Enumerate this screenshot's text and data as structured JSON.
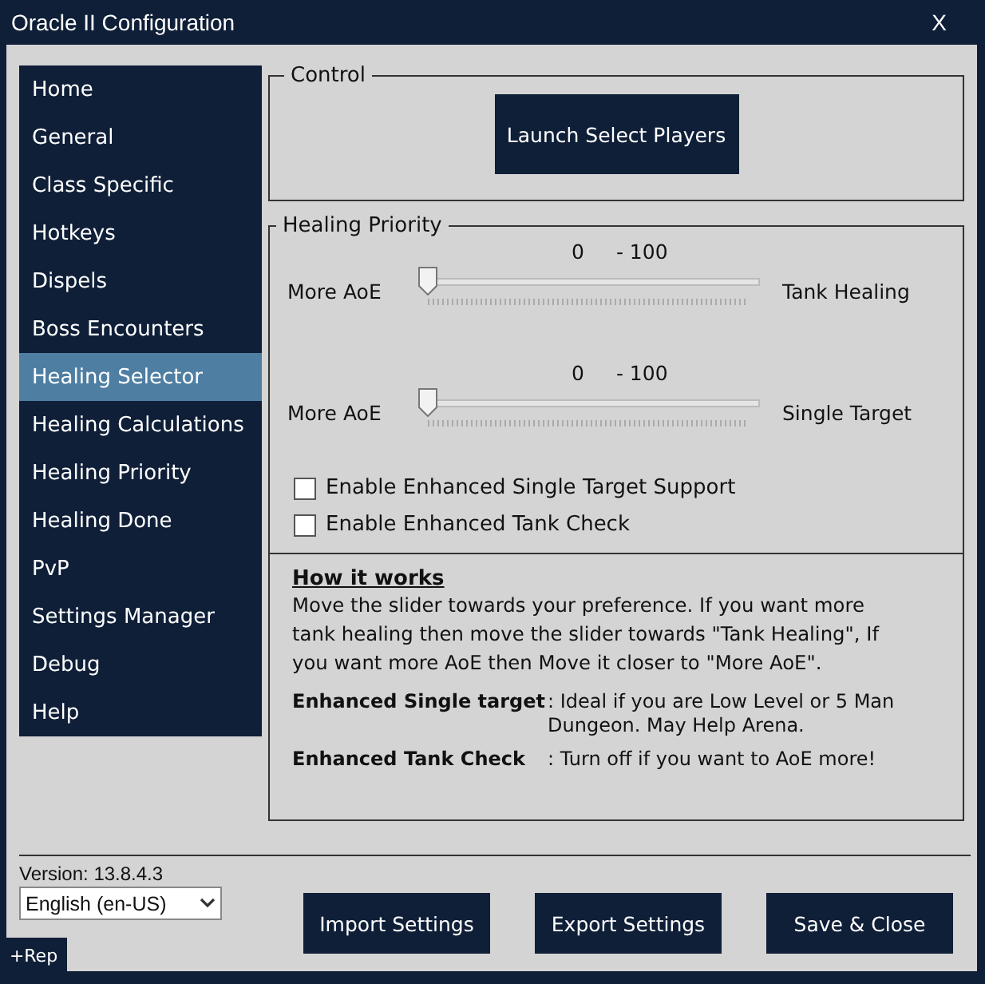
{
  "window": {
    "title": "Oracle II Configuration",
    "close": "X"
  },
  "sidebar": {
    "items": [
      {
        "label": "Home",
        "selected": false
      },
      {
        "label": "General",
        "selected": false
      },
      {
        "label": "Class Specific",
        "selected": false
      },
      {
        "label": "Hotkeys",
        "selected": false
      },
      {
        "label": "Dispels",
        "selected": false
      },
      {
        "label": "Boss Encounters",
        "selected": false
      },
      {
        "label": "Healing Selector",
        "selected": true
      },
      {
        "label": "Healing Calculations",
        "selected": false
      },
      {
        "label": "Healing Priority",
        "selected": false
      },
      {
        "label": "Healing Done",
        "selected": false
      },
      {
        "label": "PvP",
        "selected": false
      },
      {
        "label": "Settings Manager",
        "selected": false
      },
      {
        "label": "Debug",
        "selected": false
      },
      {
        "label": "Help",
        "selected": false
      }
    ]
  },
  "control": {
    "title": "Control",
    "button": "Launch Select Players"
  },
  "healing_priority": {
    "title": "Healing Priority",
    "sliders": [
      {
        "value": "0",
        "range": "- 100",
        "left_label": "More AoE",
        "right_label": "Tank Healing",
        "level": 0
      },
      {
        "value": "0",
        "range": "- 100",
        "left_label": "More AoE",
        "right_label": "Single Target",
        "level": 0
      }
    ],
    "checkboxes": [
      {
        "label": "Enable Enhanced Single Target Support",
        "checked": false
      },
      {
        "label": "Enable Enhanced Tank Check",
        "checked": false
      }
    ],
    "help": {
      "heading": "How it works",
      "text": "Move the slider towards your preference. If you want more tank healing then move the slider towards  \"Tank Healing\", If you want more AoE then Move it closer to \"More AoE\".",
      "definitions": [
        {
          "term": "Enhanced Single target",
          "description": ": Ideal if you are Low Level or 5 Man Dungeon. May Help Arena."
        },
        {
          "term": "Enhanced Tank Check",
          "description": ": Turn off if you want to AoE more!"
        }
      ]
    }
  },
  "footer": {
    "version": "Version: 13.8.4.3",
    "language": "English (en-US)",
    "buttons": [
      "Import Settings",
      "Export Settings",
      "Save & Close"
    ],
    "rep_tab": "+Rep"
  }
}
